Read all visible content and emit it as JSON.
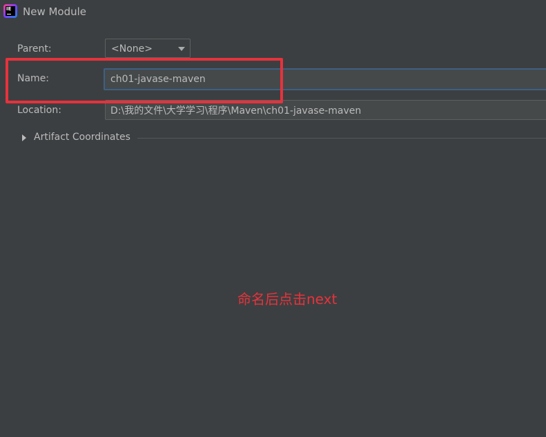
{
  "window": {
    "title": "New Module",
    "app_icon": "intellij-idea-icon",
    "app_icon_text": "IE"
  },
  "form": {
    "parent": {
      "label": "Parent:",
      "value": "<None>"
    },
    "name": {
      "label": "Name:",
      "value": "ch01-javase-maven"
    },
    "location": {
      "label": "Location:",
      "value": "D:\\我的文件\\大学学习\\程序\\Maven\\ch01-javase-maven"
    }
  },
  "artifact_section": {
    "label": "Artifact Coordinates",
    "expanded": false
  },
  "annotation": {
    "text": "命名后点击next",
    "color": "#e8323c"
  },
  "colors": {
    "background": "#3c3f41",
    "input_background": "#45494a",
    "focus_border": "#3d6185",
    "highlight": "#e8323c"
  }
}
